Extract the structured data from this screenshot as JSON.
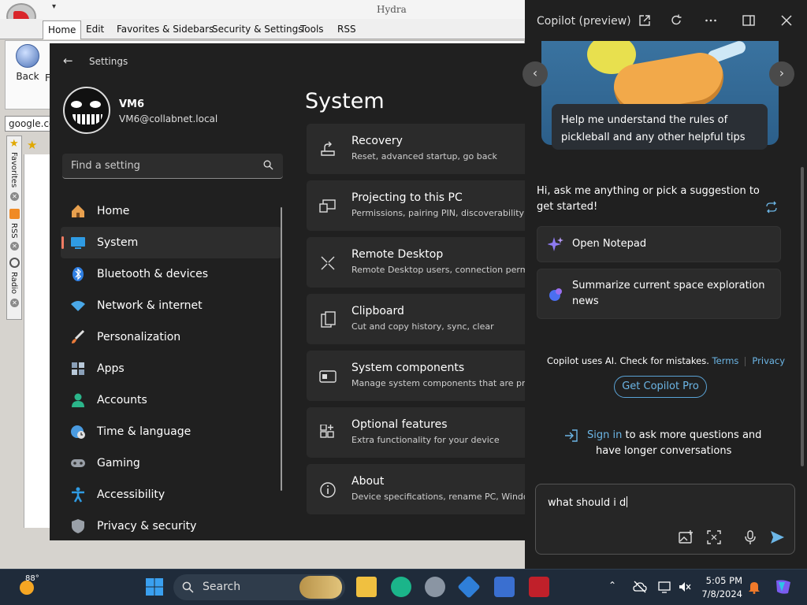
{
  "browser": {
    "quick_access": "▾",
    "window_title": "Hydra",
    "tabs": [
      "Home",
      "Edit",
      "Favorites & Sidebars",
      "Security & Settings",
      "Tools",
      "RSS"
    ],
    "back_label": "Back",
    "forward_label": "Fo",
    "address": "google.co",
    "side_tabs": [
      "Favorites",
      "RSS",
      "Radio"
    ]
  },
  "settings": {
    "window_title": "Settings",
    "user_name": "VM6",
    "user_email": "VM6@collabnet.local",
    "search_placeholder": "Find a setting",
    "nav": [
      {
        "label": "Home",
        "icon": "home-icon",
        "color": "#e8a04e"
      },
      {
        "label": "System",
        "icon": "system-icon",
        "color": "#2f9be3"
      },
      {
        "label": "Bluetooth & devices",
        "icon": "bluetooth-icon",
        "color": "#2f7fe3"
      },
      {
        "label": "Network & internet",
        "icon": "wifi-icon",
        "color": "#4aa8e8"
      },
      {
        "label": "Personalization",
        "icon": "brush-icon",
        "color": "#e87a3a"
      },
      {
        "label": "Apps",
        "icon": "apps-icon",
        "color": "#8aa0b8"
      },
      {
        "label": "Accounts",
        "icon": "person-icon",
        "color": "#2bb58a"
      },
      {
        "label": "Time & language",
        "icon": "clock-globe-icon",
        "color": "#4a9be0"
      },
      {
        "label": "Gaming",
        "icon": "gamepad-icon",
        "color": "#9aa0a8"
      },
      {
        "label": "Accessibility",
        "icon": "accessibility-icon",
        "color": "#2f9be3"
      },
      {
        "label": "Privacy & security",
        "icon": "shield-icon",
        "color": "#9aa0a8"
      }
    ],
    "active_nav": "System",
    "page_title": "System",
    "items": [
      {
        "title": "Recovery",
        "subtitle": "Reset, advanced startup, go back",
        "icon": "recovery-icon"
      },
      {
        "title": "Projecting to this PC",
        "subtitle": "Permissions, pairing PIN, discoverability",
        "icon": "projecting-icon"
      },
      {
        "title": "Remote Desktop",
        "subtitle": "Remote Desktop users, connection perm",
        "icon": "remote-desktop-icon"
      },
      {
        "title": "Clipboard",
        "subtitle": "Cut and copy history, sync, clear",
        "icon": "clipboard-icon"
      },
      {
        "title": "System components",
        "subtitle": "Manage system components that are pre",
        "icon": "system-components-icon"
      },
      {
        "title": "Optional features",
        "subtitle": "Extra functionality for your device",
        "icon": "optional-features-icon"
      },
      {
        "title": "About",
        "subtitle": "Device specifications, rename PC, Windo",
        "icon": "info-icon"
      }
    ]
  },
  "copilot": {
    "title": "Copilot (preview)",
    "suggestion_card": "Help me understand the rules of pickleball and any other helpful tips",
    "greeting": "Hi, ask me anything or pick a suggestion to get started!",
    "chips": [
      {
        "label": "Open Notepad",
        "icon": "sparkle-icon"
      },
      {
        "label": "Summarize current space exploration news",
        "icon": "planet-icon"
      }
    ],
    "disclaimer": "Copilot uses AI. Check for mistakes.",
    "terms_link": "Terms",
    "privacy_link": "Privacy",
    "pro_button": "Get Copilot Pro",
    "signin_link": "Sign in",
    "signin_rest": "to ask more questions and",
    "signin_line2": "have longer conversations",
    "input_value": "what should i d",
    "accent": "#6cb6e6"
  },
  "taskbar": {
    "temperature": "88°",
    "search_label": "Search",
    "time": "5:05 PM",
    "date": "7/8/2024"
  }
}
